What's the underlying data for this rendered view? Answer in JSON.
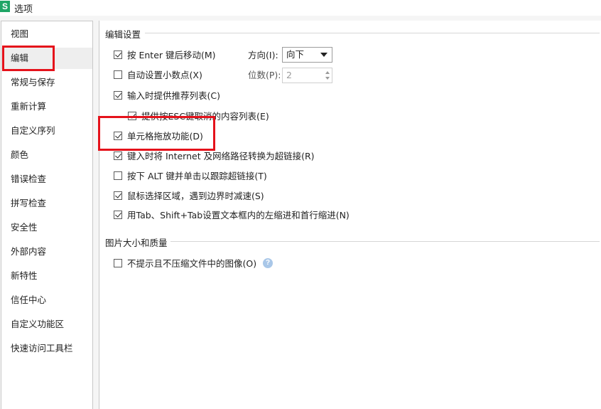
{
  "window": {
    "title": "选项",
    "app_icon_letter": "S"
  },
  "sidebar": {
    "items": [
      {
        "label": "视图"
      },
      {
        "label": "编辑"
      },
      {
        "label": "常规与保存"
      },
      {
        "label": "重新计算"
      },
      {
        "label": "自定义序列"
      },
      {
        "label": "颜色"
      },
      {
        "label": "错误检查"
      },
      {
        "label": "拼写检查"
      },
      {
        "label": "安全性"
      },
      {
        "label": "外部内容"
      },
      {
        "label": "新特性"
      },
      {
        "label": "信任中心"
      },
      {
        "label": "自定义功能区"
      },
      {
        "label": "快速访问工具栏"
      }
    ],
    "selected": "编辑"
  },
  "edit_settings": {
    "header": "编辑设置",
    "options": [
      {
        "label": "按 Enter 键后移动(M)",
        "checked": true
      },
      {
        "label": "自动设置小数点(X)",
        "checked": false
      },
      {
        "label": "输入时提供推荐列表(C)",
        "checked": true
      },
      {
        "label": "提供按ESC键取消的内容列表(E)",
        "checked": true
      },
      {
        "label": "单元格拖放功能(D)",
        "checked": true
      },
      {
        "label": "键入时将 Internet 及网络路径转换为超链接(R)",
        "checked": true
      },
      {
        "label": "按下 ALT 键并单击以跟踪超链接(T)",
        "checked": false
      },
      {
        "label": "鼠标选择区域，遇到边界时减速(S)",
        "checked": true
      },
      {
        "label": "用Tab、Shift+Tab设置文本框内的左缩进和首行缩进(N)",
        "checked": true
      }
    ],
    "direction": {
      "label": "方向(I):",
      "value": "向下"
    },
    "places": {
      "label": "位数(P):",
      "value": "2"
    }
  },
  "image_settings": {
    "header": "图片大小和质量",
    "option": {
      "label": "不提示且不压缩文件中的图像(O)",
      "checked": false
    },
    "help_icon": "question-icon",
    "help_glyph": "?"
  },
  "colors": {
    "highlight": "#e5121b",
    "app_icon": "#1fa566",
    "selected_item_bg": "#eeeeee"
  }
}
